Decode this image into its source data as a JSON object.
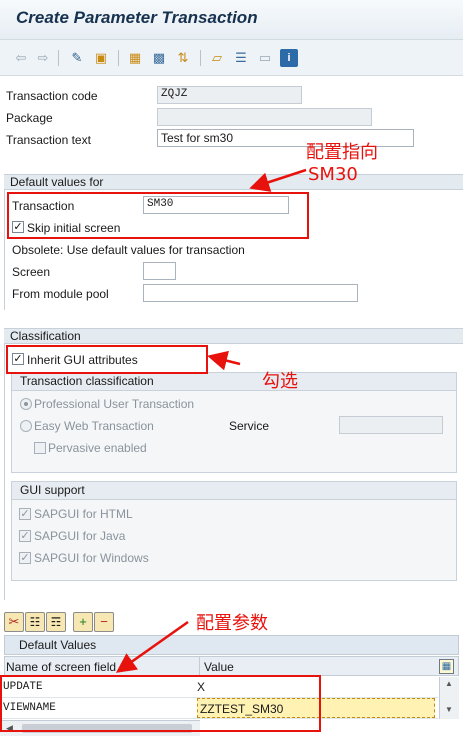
{
  "title": "Create Parameter Transaction",
  "toolbar": {
    "icons": [
      "back-icon",
      "forward-icon",
      "edit-icon",
      "other-object-icon",
      "hierarchy-icon",
      "where-used-icon",
      "transport-icon",
      "info-icon"
    ]
  },
  "header_fields": {
    "transaction_code_label": "Transaction code",
    "transaction_code_value": "ZQJZ",
    "package_label": "Package",
    "package_value": "",
    "transaction_text_label": "Transaction text",
    "transaction_text_value": "Test for sm30"
  },
  "default_values": {
    "group_title": "Default values for",
    "transaction_label": "Transaction",
    "transaction_value": "SM30",
    "skip_initial_label": "Skip initial screen",
    "skip_initial_checked": true,
    "obsolete_text": "Obsolete: Use default values for transaction",
    "screen_label": "Screen",
    "screen_value": "",
    "module_pool_label": "From module pool",
    "module_pool_value": ""
  },
  "classification": {
    "group_title": "Classification",
    "inherit_gui_label": "Inherit GUI attributes",
    "inherit_gui_checked": true,
    "tx_class_title": "Transaction classification",
    "professional_label": "Professional User Transaction",
    "easy_web_label": "Easy Web Transaction",
    "service_label": "Service",
    "service_value": "",
    "pervasive_label": "Pervasive enabled",
    "gui_support_title": "GUI support",
    "gui_html_label": "SAPGUI for HTML",
    "gui_java_label": "SAPGUI for Java",
    "gui_windows_label": "SAPGUI for Windows"
  },
  "default_table": {
    "title": "Default Values",
    "col_name": "Name of screen field",
    "col_value": "Value",
    "rows": [
      {
        "name": "UPDATE",
        "value": "X"
      },
      {
        "name": "VIEWNAME",
        "value": "ZZTEST_SM30"
      }
    ]
  },
  "annotations": {
    "target_line1": "配置指向",
    "target_line2": "SM30",
    "check": "勾选",
    "params": "配置参数"
  },
  "colors": {
    "annotation_red": "#e8120c",
    "title_blue": "#16324f",
    "selected_cell": "#fff2b3"
  }
}
